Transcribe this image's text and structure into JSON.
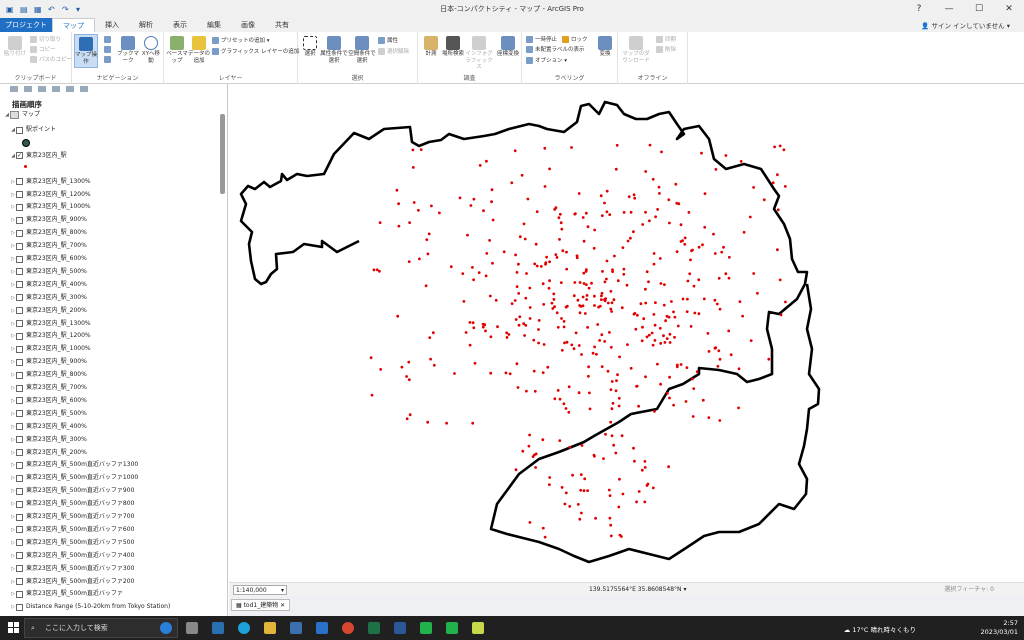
{
  "window": {
    "title": "日本-コンパクトシティ - マップ - ArcGIS Pro",
    "help": "?"
  },
  "tabs": [
    "プロジェクト",
    "マップ",
    "挿入",
    "解析",
    "表示",
    "編集",
    "画像",
    "共有"
  ],
  "signin": "サイン インしていません",
  "ribbon": {
    "clipboard": {
      "label": "クリップボード",
      "paste": "貼り付け",
      "cut": "切り取り",
      "copy": "コピー",
      "copy_path": "パスのコピー"
    },
    "navigation": {
      "label": "ナビゲーション",
      "explore": "マップ操作",
      "bookmarks": "ブックマーク",
      "goto_xy": "XYへ移動"
    },
    "layer": {
      "label": "レイヤー",
      "basemap": "ベースマップ",
      "add_data": "データの追加",
      "add_preset": "プリセットの追加",
      "add_graphics": "グラフィックス レイヤーの追加"
    },
    "selection": {
      "label": "選択",
      "select": "選択",
      "by_attr": "属性条件で選択",
      "by_loc": "空間条件で選択",
      "attributes": "属性",
      "clear": "選択解除"
    },
    "inquiry": {
      "label": "調査",
      "measure": "計測",
      "locate": "場所検索",
      "infographics": "インフォグラフィックス",
      "coordinate": "座標変換"
    },
    "labeling": {
      "label": "ラベリング",
      "pause": "一時停止",
      "lock": "ロック",
      "view_unplaced": "未配置ラベルの表示",
      "more": "オプション",
      "convert": "変換"
    },
    "offline": {
      "label": "オフライン",
      "download": "マップのダウンロード",
      "sync": "同期",
      "remove": "削除"
    }
  },
  "contents": {
    "heading": "描画順序",
    "map": "マップ",
    "layers": [
      {
        "name": "駅ポイント",
        "checked": false,
        "level": 1,
        "swatch": "#2e5a50"
      },
      {
        "name": "東京23区内_駅",
        "checked": true,
        "level": 1,
        "swatch": "#e00000"
      },
      {
        "name": "東京23区内_駅_1300%",
        "checked": false,
        "level": 1
      },
      {
        "name": "東京23区内_駅_1200%",
        "checked": false,
        "level": 1
      },
      {
        "name": "東京23区内_駅_1000%",
        "checked": false,
        "level": 1
      },
      {
        "name": "東京23区内_駅_900%",
        "checked": false,
        "level": 1
      },
      {
        "name": "東京23区内_駅_800%",
        "checked": false,
        "level": 1
      },
      {
        "name": "東京23区内_駅_700%",
        "checked": false,
        "level": 1
      },
      {
        "name": "東京23区内_駅_600%",
        "checked": false,
        "level": 1
      },
      {
        "name": "東京23区内_駅_500%",
        "checked": false,
        "level": 1
      },
      {
        "name": "東京23区内_駅_400%",
        "checked": false,
        "level": 1
      },
      {
        "name": "東京23区内_駅_300%",
        "checked": false,
        "level": 1
      },
      {
        "name": "東京23区内_駅_200%",
        "checked": false,
        "level": 1
      },
      {
        "name": "東京23区内_駅_1300%",
        "checked": false,
        "level": 1
      },
      {
        "name": "東京23区内_駅_1200%",
        "checked": false,
        "level": 1
      },
      {
        "name": "東京23区内_駅_1000%",
        "checked": false,
        "level": 1
      },
      {
        "name": "東京23区内_駅_900%",
        "checked": false,
        "level": 1
      },
      {
        "name": "東京23区内_駅_800%",
        "checked": false,
        "level": 1
      },
      {
        "name": "東京23区内_駅_700%",
        "checked": false,
        "level": 1
      },
      {
        "name": "東京23区内_駅_600%",
        "checked": false,
        "level": 1
      },
      {
        "name": "東京23区内_駅_500%",
        "checked": false,
        "level": 1
      },
      {
        "name": "東京23区内_駅_400%",
        "checked": false,
        "level": 1
      },
      {
        "name": "東京23区内_駅_300%",
        "checked": false,
        "level": 1
      },
      {
        "name": "東京23区内_駅_200%",
        "checked": false,
        "level": 1
      },
      {
        "name": "東京23区内_駅_500m直近バッファ1300",
        "checked": false,
        "level": 1
      },
      {
        "name": "東京23区内_駅_500m直近バッファ1000",
        "checked": false,
        "level": 1
      },
      {
        "name": "東京23区内_駅_500m直近バッファ900",
        "checked": false,
        "level": 1
      },
      {
        "name": "東京23区内_駅_500m直近バッファ800",
        "checked": false,
        "level": 1
      },
      {
        "name": "東京23区内_駅_500m直近バッファ700",
        "checked": false,
        "level": 1
      },
      {
        "name": "東京23区内_駅_500m直近バッファ600",
        "checked": false,
        "level": 1
      },
      {
        "name": "東京23区内_駅_500m直近バッファ500",
        "checked": false,
        "level": 1
      },
      {
        "name": "東京23区内_駅_500m直近バッファ400",
        "checked": false,
        "level": 1
      },
      {
        "name": "東京23区内_駅_500m直近バッファ300",
        "checked": false,
        "level": 1
      },
      {
        "name": "東京23区内_駅_500m直近バッファ200",
        "checked": false,
        "level": 1
      },
      {
        "name": "東京23区内_駅_500m直近バッファ",
        "checked": false,
        "level": 1
      },
      {
        "name": "Distance Range (5-10-20km from Tokyo Station)",
        "checked": false,
        "level": 1
      }
    ]
  },
  "status": {
    "scale": "1:140,000",
    "coordinates": "139.5175564°E 35.8608548°N",
    "selected_features": "選択フィーチャ: 0"
  },
  "doc_tab": "tod1_建築物",
  "taskbar": {
    "search": "ここに入力して検索",
    "weather": "17°C  晴れ時々くもり",
    "time": "2:57",
    "date": "2023/03/01"
  },
  "colors": {
    "accent": "#1f6fc5",
    "station": "#e00000",
    "boundary": "#000000",
    "taskbar": "#202020"
  }
}
